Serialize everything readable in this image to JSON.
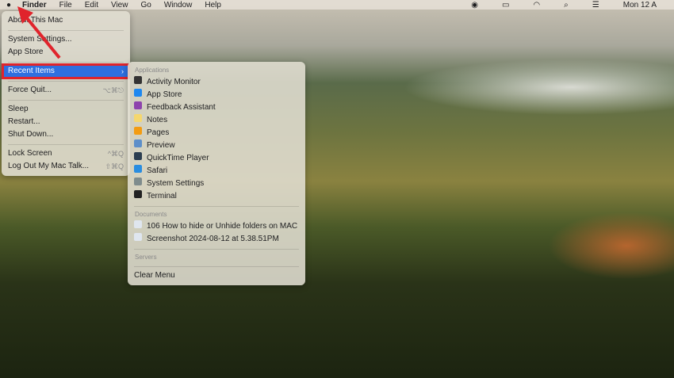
{
  "menubar": {
    "apple": "",
    "items": [
      "Finder",
      "File",
      "Edit",
      "View",
      "Go",
      "Window",
      "Help"
    ],
    "clock": "Mon 12 A"
  },
  "apple_menu": [
    {
      "label": "About This Mac"
    },
    {
      "sep": true
    },
    {
      "label": "System Settings..."
    },
    {
      "label": "App Store"
    },
    {
      "sep": true
    },
    {
      "label": "Recent Items",
      "shortcut": "›",
      "selected": true
    },
    {
      "sep": true
    },
    {
      "label": "Force Quit...",
      "shortcut": "⌥⌘⎋"
    },
    {
      "sep": true
    },
    {
      "label": "Sleep"
    },
    {
      "label": "Restart..."
    },
    {
      "label": "Shut Down..."
    },
    {
      "sep": true
    },
    {
      "label": "Lock Screen",
      "shortcut": "^⌘Q"
    },
    {
      "label": "Log Out My Mac Talk...",
      "shortcut": "⇧⌘Q"
    }
  ],
  "recent": {
    "applications_header": "Applications",
    "applications": [
      {
        "label": "Activity Monitor",
        "color": "#333333"
      },
      {
        "label": "App Store",
        "color": "#1e88f0"
      },
      {
        "label": "Feedback Assistant",
        "color": "#8e44ad"
      },
      {
        "label": "Notes",
        "color": "#f5d76e"
      },
      {
        "label": "Pages",
        "color": "#f39c12"
      },
      {
        "label": "Preview",
        "color": "#5d8fc9"
      },
      {
        "label": "QuickTime Player",
        "color": "#2c3e50"
      },
      {
        "label": "Safari",
        "color": "#2a8de0"
      },
      {
        "label": "System Settings",
        "color": "#7f8c8d"
      },
      {
        "label": "Terminal",
        "color": "#222222"
      }
    ],
    "documents_header": "Documents",
    "documents": [
      {
        "label": "106 How to hide or Unhide folders on MAC"
      },
      {
        "label": "Screenshot 2024-08-12 at 5.38.51PM"
      }
    ],
    "servers_header": "Servers",
    "clear": "Clear Menu"
  }
}
